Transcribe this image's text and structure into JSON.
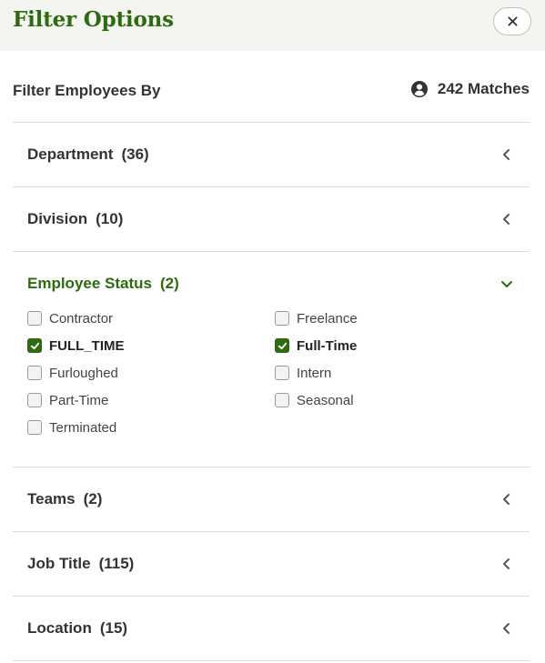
{
  "header": {
    "title": "Filter Options"
  },
  "filter_by_label": "Filter Employees By",
  "matches_label": "242 Matches",
  "sections": [
    {
      "label": "Department",
      "count": "(36)",
      "open": false
    },
    {
      "label": "Division",
      "count": "(10)",
      "open": false
    },
    {
      "label": "Employee Status",
      "count": "(2)",
      "open": true
    },
    {
      "label": "Teams",
      "count": "(2)",
      "open": false
    },
    {
      "label": "Job Title",
      "count": "(115)",
      "open": false
    },
    {
      "label": "Location",
      "count": "(15)",
      "open": false
    }
  ],
  "employee_status_options": [
    {
      "label": "Contractor",
      "checked": false
    },
    {
      "label": "Freelance",
      "checked": false
    },
    {
      "label": "FULL_TIME",
      "checked": true
    },
    {
      "label": "Full-Time",
      "checked": true
    },
    {
      "label": "Furloughed",
      "checked": false
    },
    {
      "label": "Intern",
      "checked": false
    },
    {
      "label": "Part-Time",
      "checked": false
    },
    {
      "label": "Seasonal",
      "checked": false
    },
    {
      "label": "Terminated",
      "checked": false
    }
  ],
  "colors": {
    "accent": "#2e6b10",
    "header_bg": "#f4f4f1",
    "divider": "#dcdcdc"
  },
  "icons": {
    "close": "close-icon",
    "matches": "user-circle-icon",
    "collapsed": "chevron-left-icon",
    "expanded": "chevron-down-icon",
    "check": "check-icon"
  }
}
